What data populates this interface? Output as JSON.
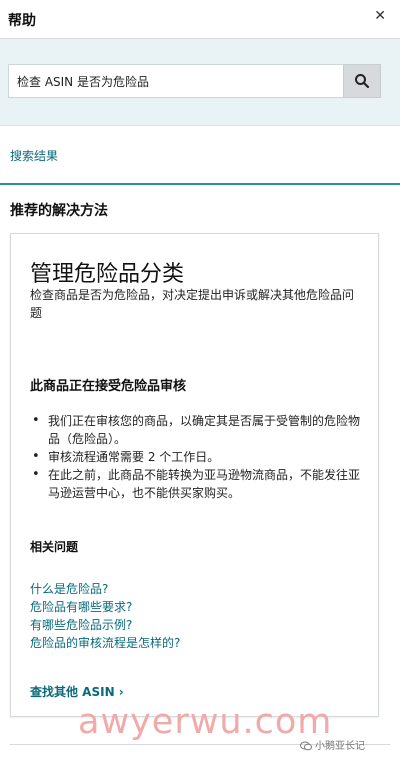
{
  "header": {
    "title": "帮助",
    "close_label": "✕"
  },
  "search": {
    "value": "检查 ASIN 是否为危险品"
  },
  "results_link": "搜索结果",
  "section_title": "推荐的解决方法",
  "card": {
    "title": "管理危险品分类",
    "description": "检查商品是否为危险品，对决定提出申诉或解决其他危险品问题",
    "status_heading": "此商品正在接受危险品审核",
    "bullets": [
      "我们正在审核您的商品，以确定其是否属于受管制的危险物品（危险品）。",
      "审核流程通常需要 2 个工作日。",
      "在此之前，此商品不能转换为亚马逊物流商品，不能发往亚马逊运营中心，也不能供买家购买。"
    ],
    "related_heading": "相关问题",
    "questions": [
      "什么是危险品?",
      "危险品有哪些要求?",
      "有哪些危险品示例?",
      "危险品的审核流程是怎样的?"
    ],
    "find_link": "查找其他 ASIN ›"
  },
  "watermark": "awyerwu.com",
  "wechat_mark": "小鹅亚长记",
  "colors": {
    "accent": "#0a6a7a",
    "divider": "#2b8fa1",
    "search_band": "#e9f2f5"
  }
}
